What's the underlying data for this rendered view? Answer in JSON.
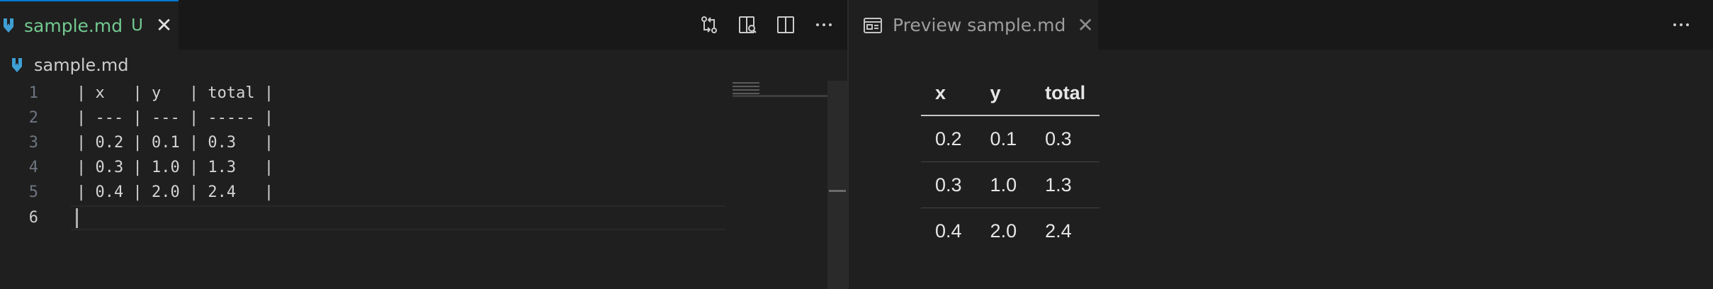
{
  "editor": {
    "tab": {
      "label": "sample.md",
      "badge": "U",
      "close": "✕"
    },
    "breadcrumb": "sample.md",
    "actions": [
      "git-compare-icon",
      "open-preview-to-side-icon",
      "split-editor-icon",
      "more-actions-icon"
    ],
    "lines": [
      {
        "number": "1",
        "text": "| x   | y   | total |"
      },
      {
        "number": "2",
        "text": "| --- | --- | ----- |"
      },
      {
        "number": "3",
        "text": "| 0.2 | 0.1 | 0.3   |"
      },
      {
        "number": "4",
        "text": "| 0.3 | 1.0 | 1.3   |"
      },
      {
        "number": "5",
        "text": "| 0.4 | 2.0 | 2.4   |"
      },
      {
        "number": "6",
        "text": ""
      }
    ]
  },
  "preview": {
    "tab": {
      "label": "Preview sample.md",
      "close": "✕"
    },
    "more": "···",
    "table": {
      "headers": [
        "x",
        "y",
        "total"
      ],
      "rows": [
        [
          "0.2",
          "0.1",
          "0.3"
        ],
        [
          "0.3",
          "1.0",
          "1.3"
        ],
        [
          "0.4",
          "2.0",
          "2.4"
        ]
      ]
    }
  },
  "colors": {
    "accent": "#0078d4",
    "untracked": "#73c991",
    "markdown_icon": "#3f9fd5"
  }
}
